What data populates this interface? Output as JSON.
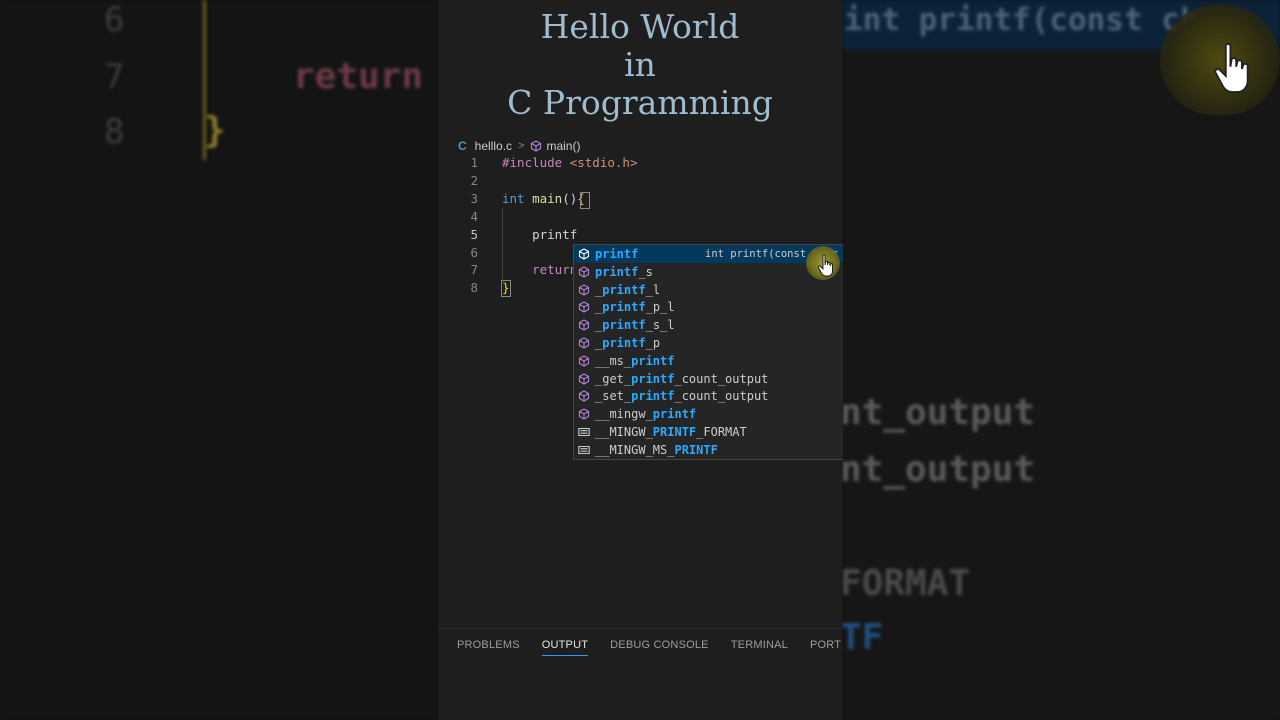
{
  "title": {
    "line1": "Hello World",
    "line2": "in",
    "line3": "C Programming"
  },
  "breadcrumb": {
    "lang_glyph": "C",
    "file": "helllo.c",
    "separator": ">",
    "symbol": "main()"
  },
  "editor": {
    "active_line": 5,
    "lines": [
      {
        "num": "1",
        "segments": [
          {
            "t": "#include ",
            "c": "inc"
          },
          {
            "t": "<stdio.h>",
            "c": "str"
          }
        ]
      },
      {
        "num": "2",
        "segments": []
      },
      {
        "num": "3",
        "segments": [
          {
            "t": "int",
            "c": "type"
          },
          {
            "t": " "
          },
          {
            "t": "main",
            "c": "fn"
          },
          {
            "t": "()"
          },
          {
            "t": "{",
            "c": "brace"
          }
        ]
      },
      {
        "num": "4",
        "segments": []
      },
      {
        "num": "5",
        "segments": [
          {
            "t": "    printf"
          }
        ]
      },
      {
        "num": "6",
        "segments": []
      },
      {
        "num": "7",
        "segments": [
          {
            "t": "    "
          },
          {
            "t": "return",
            "c": "ctrl"
          }
        ]
      },
      {
        "num": "8",
        "segments": [
          {
            "t": "}",
            "c": "brace"
          }
        ]
      }
    ]
  },
  "suggestions": {
    "selected_detail": "int printf(const char *",
    "items": [
      {
        "kind": "method",
        "pre": "",
        "hl": "printf",
        "post": "",
        "selected": true
      },
      {
        "kind": "method",
        "pre": "",
        "hl": "printf",
        "post": "_s"
      },
      {
        "kind": "method",
        "pre": "_",
        "hl": "printf",
        "post": "_l"
      },
      {
        "kind": "method",
        "pre": "_",
        "hl": "printf",
        "post": "_p_l"
      },
      {
        "kind": "method",
        "pre": "_",
        "hl": "printf",
        "post": "_s_l"
      },
      {
        "kind": "method",
        "pre": "_",
        "hl": "printf",
        "post": "_p"
      },
      {
        "kind": "method",
        "pre": "__ms_",
        "hl": "printf",
        "post": ""
      },
      {
        "kind": "method",
        "pre": "_get_",
        "hl": "printf",
        "post": "_count_output"
      },
      {
        "kind": "method",
        "pre": "_set_",
        "hl": "printf",
        "post": "_count_output"
      },
      {
        "kind": "method",
        "pre": "__mingw_",
        "hl": "printf",
        "post": ""
      },
      {
        "kind": "text",
        "pre": "__MINGW_",
        "hl": "PRINTF",
        "post": "_FORMAT"
      },
      {
        "kind": "text",
        "pre": "__MINGW_MS_",
        "hl": "PRINTF",
        "post": ""
      }
    ]
  },
  "panel_tabs": [
    {
      "label": "PROBLEMS",
      "active": false
    },
    {
      "label": "OUTPUT",
      "active": true
    },
    {
      "label": "DEBUG CONSOLE",
      "active": false
    },
    {
      "label": "TERMINAL",
      "active": false
    },
    {
      "label": "PORTS",
      "active": false
    }
  ],
  "background": {
    "left_line_numbers": [
      "6",
      "7",
      "8"
    ],
    "left_return": "return",
    "left_brace": "}",
    "right_top": "int printf(const char",
    "right_lines": [
      "nt_output",
      "nt_output",
      "FORMAT",
      "TF"
    ]
  },
  "colors": {
    "accent": "#3794ff",
    "highlight": "#2aaaff",
    "title": "#9fbccf",
    "selection": "#04395e"
  }
}
